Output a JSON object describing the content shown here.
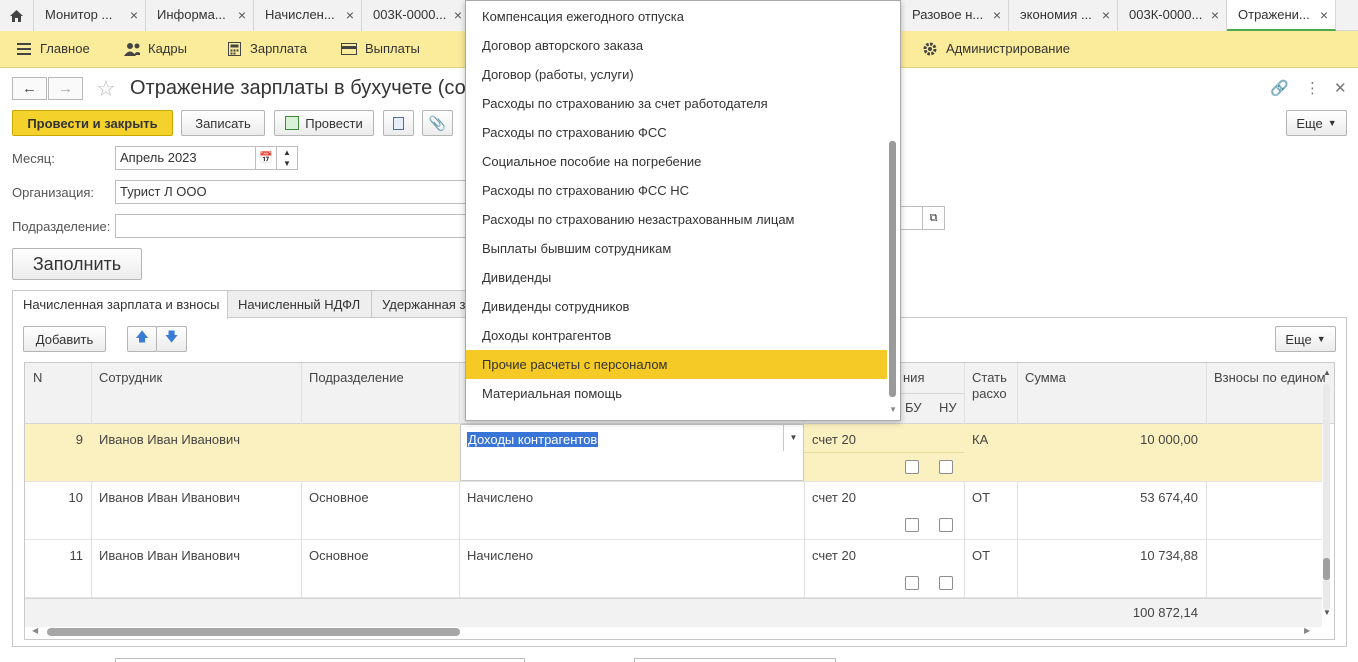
{
  "tabs": [
    {
      "label": "Монитор ..."
    },
    {
      "label": "Информа..."
    },
    {
      "label": "Начислен..."
    },
    {
      "label": "003К-0000..."
    },
    {
      "label": "Разовое н..."
    },
    {
      "label": "экономия ..."
    },
    {
      "label": "003К-0000..."
    },
    {
      "label": "Отражени..."
    }
  ],
  "tab_close": "×",
  "sections": {
    "main": "Главное",
    "hr": "Кадры",
    "salary": "Зарплата",
    "payments": "Выплаты",
    "admin": "Администрирование"
  },
  "form": {
    "title": "Отражение зарплаты в бухучете (созд",
    "btn_post_close": "Провести и закрыть",
    "btn_save": "Записать",
    "btn_post": "Провести",
    "btn_more": "Еще",
    "btn_fill": "Заполнить",
    "month_label": "Месяц:",
    "month_value": "Апрель 2023",
    "org_label": "Организация:",
    "org_value": "Турист Л ООО",
    "dept_label": "Подразделение:",
    "dept_value": ""
  },
  "inner_tabs": [
    {
      "label": "Начисленная зарплата и взносы"
    },
    {
      "label": "Начисленный НДФЛ"
    },
    {
      "label": "Удержанная з"
    }
  ],
  "table": {
    "add_label": "Добавить",
    "more_label": "Еще",
    "headers": {
      "n": "N",
      "employee": "Сотрудник",
      "dept": "Подразделение",
      "ot_part": "ния",
      "bu": "БУ",
      "nu": "НУ",
      "stat_line1": "Стать",
      "stat_line2": "расхо",
      "sum": "Сумма",
      "contrib": "Взносы по едином"
    },
    "rows": [
      {
        "n": "9",
        "employee": "Иванов Иван Иванович",
        "dept": "",
        "type": "Доходы контрагентов",
        "account": "счет 20",
        "stat": "КА",
        "sum": "10 000,00"
      },
      {
        "n": "10",
        "employee": "Иванов Иван Иванович",
        "dept": "Основное",
        "type": "Начислено",
        "account": "счет 20",
        "stat": "ОТ",
        "sum": "53 674,40"
      },
      {
        "n": "11",
        "employee": "Иванов Иван Иванович",
        "dept": "Основное",
        "type": "Начислено",
        "account": "счет 20",
        "stat": "ОТ",
        "sum": "10 734,88"
      }
    ],
    "total": "100 872,14"
  },
  "dropdown": {
    "items": [
      "Компенсация ежегодного отпуска",
      "Договор авторского заказа",
      "Договор (работы, услуги)",
      "Расходы по страхованию за счет работодателя",
      "Расходы по страхованию ФСС",
      "Социальное пособие на погребение",
      "Расходы по страхованию ФСС НС",
      "Расходы по страхованию незастрахованным лицам",
      "Выплаты бывшим сотрудникам",
      "Дивиденды",
      "Дивиденды сотрудников",
      "Доходы контрагентов",
      "Прочие расчеты с персоналом",
      "Материальная помощь"
    ],
    "highlighted": "Прочие расчеты с персоналом"
  },
  "colors": {
    "accent_yellow": "#f5d22b",
    "section_bar": "#fbec9b",
    "selected_row": "#fbf1c0",
    "highlight": "#f5c926"
  }
}
